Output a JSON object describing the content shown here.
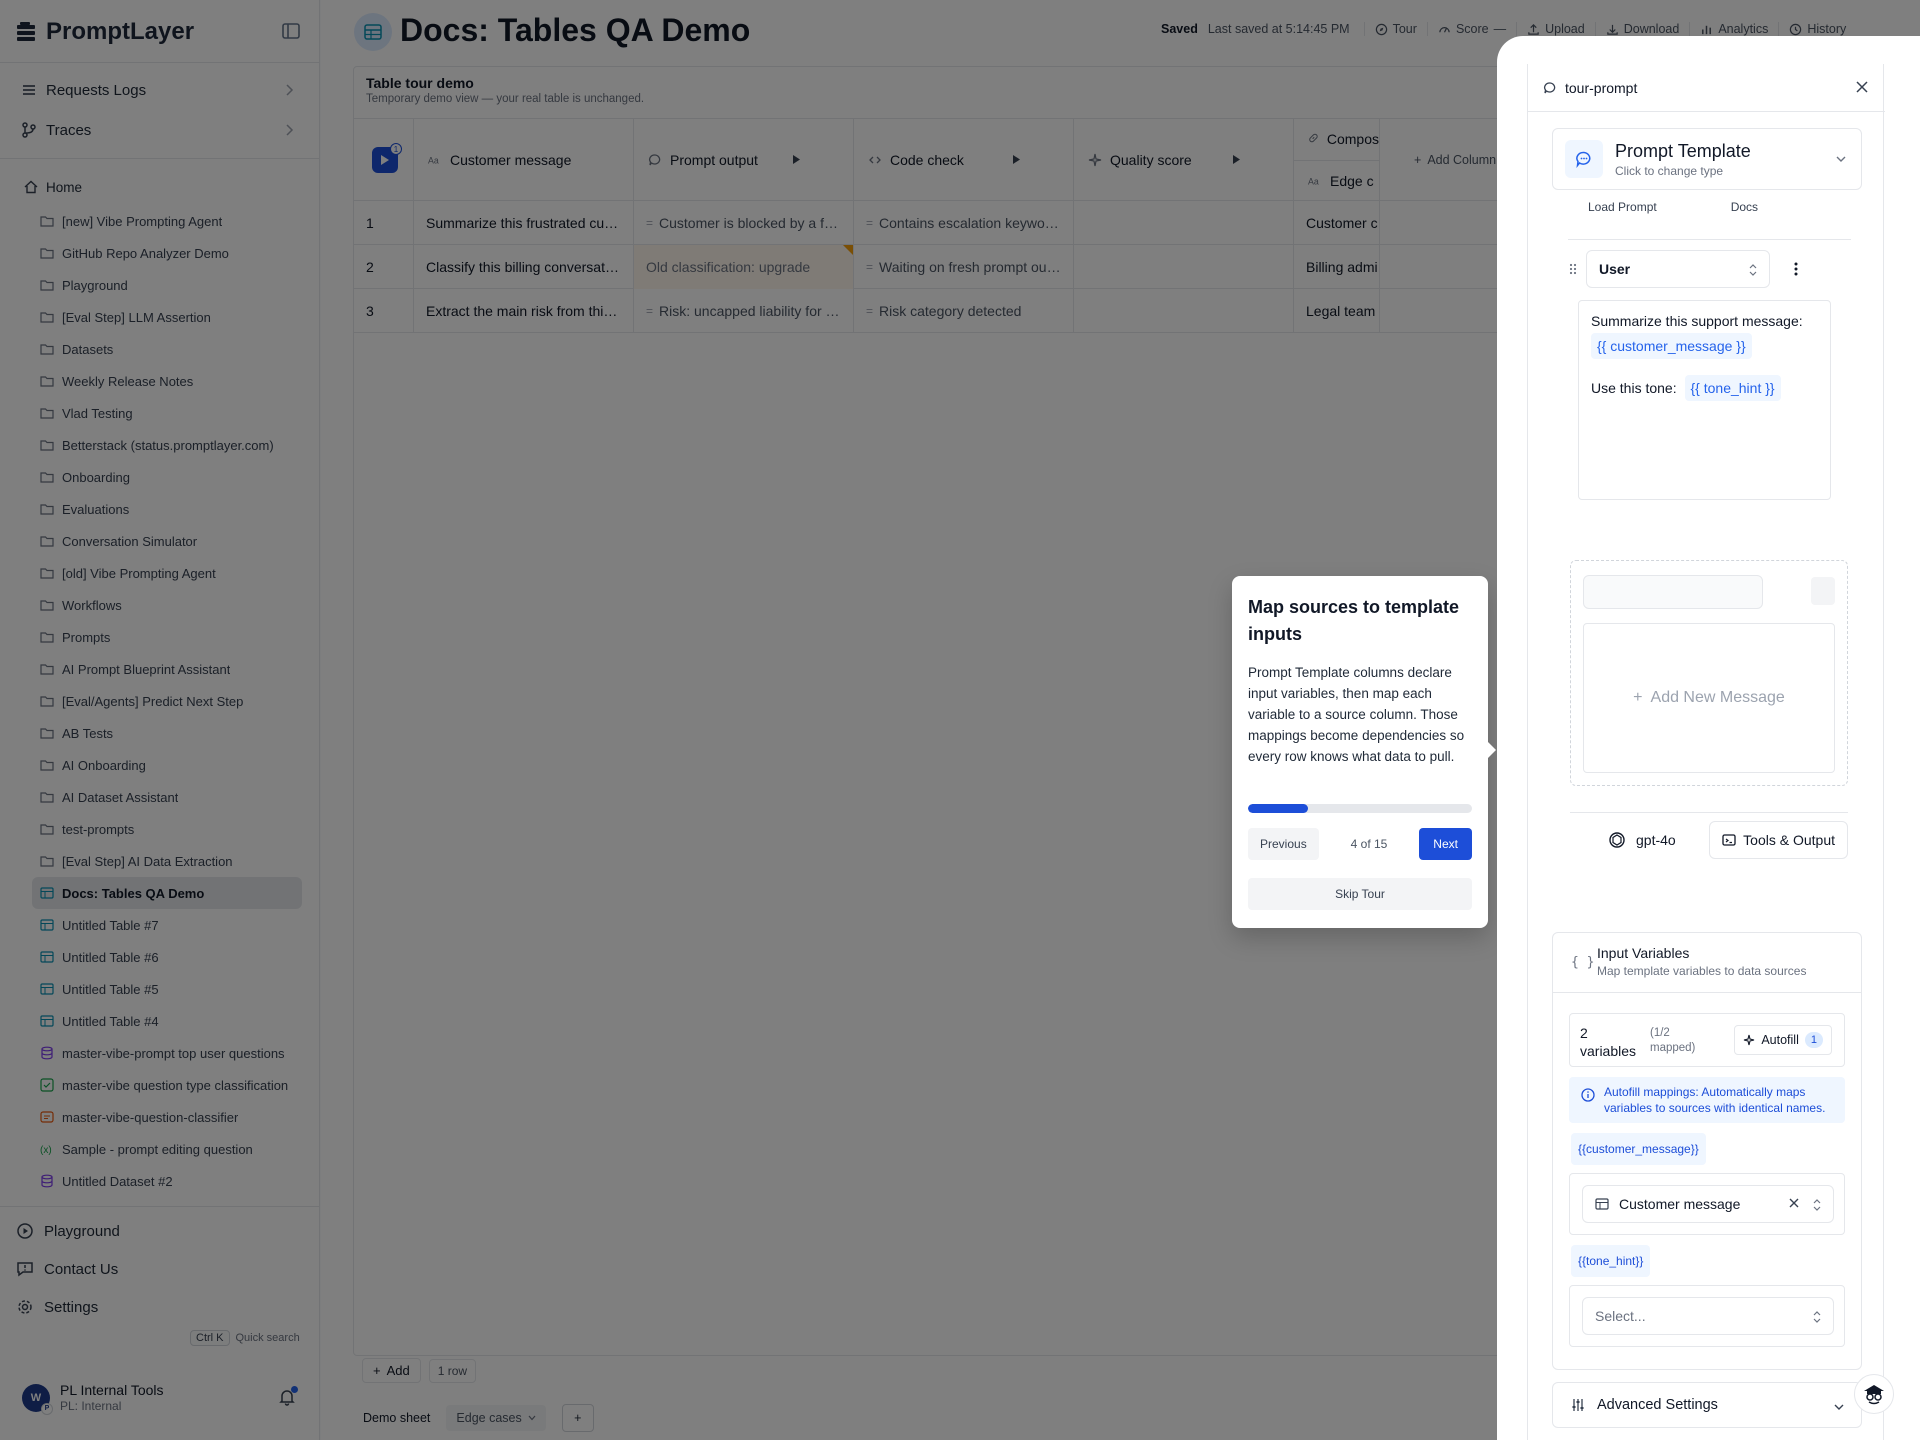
{
  "app": {
    "name": "PromptLayer",
    "collapse_icon": "sidebar-collapse-icon"
  },
  "sidebar": {
    "top_nav": [
      {
        "label": "Requests Logs",
        "icon": "list-icon"
      },
      {
        "label": "Traces",
        "icon": "branch-icon"
      }
    ],
    "home_label": "Home",
    "folders": [
      {
        "label": "[new] Vibe Prompting Agent",
        "icon": "folder"
      },
      {
        "label": "GitHub Repo Analyzer Demo",
        "icon": "folder"
      },
      {
        "label": "Playground",
        "icon": "folder"
      },
      {
        "label": "[Eval Step] LLM Assertion",
        "icon": "folder"
      },
      {
        "label": "Datasets",
        "icon": "folder"
      },
      {
        "label": "Weekly Release Notes",
        "icon": "folder"
      },
      {
        "label": "Vlad Testing",
        "icon": "folder"
      },
      {
        "label": "Betterstack (status.promptlayer.com)",
        "icon": "folder"
      },
      {
        "label": "Onboarding",
        "icon": "folder"
      },
      {
        "label": "Evaluations",
        "icon": "folder"
      },
      {
        "label": "Conversation Simulator",
        "icon": "folder"
      },
      {
        "label": "[old] Vibe Prompting Agent",
        "icon": "folder"
      },
      {
        "label": "Workflows",
        "icon": "folder"
      },
      {
        "label": "Prompts",
        "icon": "folder"
      },
      {
        "label": "AI Prompt Blueprint Assistant",
        "icon": "folder"
      },
      {
        "label": "[Eval/Agents] Predict Next Step",
        "icon": "folder"
      },
      {
        "label": "AB Tests",
        "icon": "folder"
      },
      {
        "label": "AI Onboarding",
        "icon": "folder"
      },
      {
        "label": "AI Dataset Assistant",
        "icon": "folder"
      },
      {
        "label": "test-prompts",
        "icon": "folder"
      },
      {
        "label": "[Eval Step] AI Data Extraction",
        "icon": "folder"
      },
      {
        "label": "Docs: Tables QA Demo",
        "icon": "table",
        "active": true
      },
      {
        "label": "Untitled Table #7",
        "icon": "table"
      },
      {
        "label": "Untitled Table #6",
        "icon": "table"
      },
      {
        "label": "Untitled Table #5",
        "icon": "table"
      },
      {
        "label": "Untitled Table #4",
        "icon": "table"
      },
      {
        "label": "master-vibe-prompt top user questions",
        "icon": "dataset"
      },
      {
        "label": "master-vibe question type classification",
        "icon": "eval"
      },
      {
        "label": "master-vibe-question-classifier",
        "icon": "prompt"
      },
      {
        "label": "Sample - prompt editing question",
        "icon": "variable"
      },
      {
        "label": "Untitled Dataset #2",
        "icon": "dataset"
      }
    ],
    "bottom_nav": [
      {
        "label": "Playground",
        "icon": "play-circle-icon"
      },
      {
        "label": "Contact Us",
        "icon": "message-square-icon"
      },
      {
        "label": "Settings",
        "icon": "gear-icon"
      }
    ],
    "shortcut_key": "Ctrl K",
    "shortcut_label": "Quick search",
    "user": {
      "name": "PL Internal Tools",
      "org": "PL: Internal",
      "avatar_initial": "W",
      "avatar_mini": "P"
    }
  },
  "header": {
    "title": "Docs: Tables QA Demo",
    "saved": "Saved",
    "last_saved": "Last saved at 5:14:45 PM",
    "actions": [
      "Tour",
      "Score",
      "Upload",
      "Download",
      "Analytics",
      "History"
    ],
    "score_value": "—"
  },
  "table": {
    "title": "Table tour demo",
    "subtitle": "Temporary demo view — your real table is unchanged.",
    "run_badge": "1",
    "columns": [
      {
        "label": "Customer message",
        "icon": "text-type-icon"
      },
      {
        "label": "Prompt output",
        "icon": "chat-bubble-icon"
      },
      {
        "label": "Code check",
        "icon": "code-icon"
      },
      {
        "label": "Quality score",
        "icon": "sparkle-icon"
      },
      {
        "label": "Compos",
        "icon": "link-icon"
      }
    ],
    "compose_sub": "Edge c",
    "add_column": "Add Column",
    "rows": [
      {
        "num": "1",
        "message": "Summarize this frustrated cu…",
        "output": "Customer is blocked by a f…",
        "code": "Contains escalation keywo…",
        "quality": "",
        "compose": "Customer c"
      },
      {
        "num": "2",
        "message": "Classify this billing conversat…",
        "output": "Old classification: upgrade",
        "code": "Waiting on fresh prompt ou…",
        "quality": "",
        "compose": "Billing admi"
      },
      {
        "num": "3",
        "message": "Extract the main risk from thi…",
        "output": "Risk: uncapped liability for …",
        "code": "Risk category detected",
        "quality": "",
        "compose": "Legal team"
      }
    ],
    "footer": {
      "add": "Add",
      "row_count": "1 row"
    },
    "sheets": {
      "active": "Demo sheet",
      "other": "Edge cases"
    }
  },
  "tour": {
    "title": "Map sources to template inputs",
    "body": "Prompt Template columns declare input variables, then map each variable to a source column. Those mappings become dependencies so every row knows what data to pull.",
    "step": 4,
    "total": 15,
    "progress": 0.267,
    "count_label": "4 of 15",
    "prev": "Previous",
    "next": "Next",
    "skip": "Skip Tour"
  },
  "panel": {
    "title": "tour-prompt",
    "type_title": "Prompt Template",
    "type_sub": "Click to change type",
    "cut_labels": [
      "Load Prompt",
      "Docs"
    ],
    "role": "User",
    "message_line1": "Summarize this support message:",
    "var1": "{{ customer_message }}",
    "message_line2": "Use this tone:",
    "var2": "{{ tone_hint }}",
    "add_message": "Add New Message",
    "model": "gpt-4o",
    "tools": "Tools & Output",
    "input_vars_title": "Input Variables",
    "input_vars_sub": "Map template variables to data sources",
    "var_count": "2 variables",
    "mapped": "(1/2 mapped)",
    "autofill": "Autofill",
    "autofill_count": "1",
    "info": "Autofill mappings: Automatically maps variables to sources with identical names.",
    "mappings": [
      {
        "var": "{{customer_message}}",
        "source": "Customer message",
        "mapped": true
      },
      {
        "var": "{{tone_hint}}",
        "source": "Select...",
        "mapped": false
      }
    ],
    "advanced": "Advanced Settings"
  },
  "colors": {
    "accent": "#1d4ed8",
    "overlay": "rgba(0,0,0,0.5)",
    "stale_marker": "#f59e0b"
  }
}
